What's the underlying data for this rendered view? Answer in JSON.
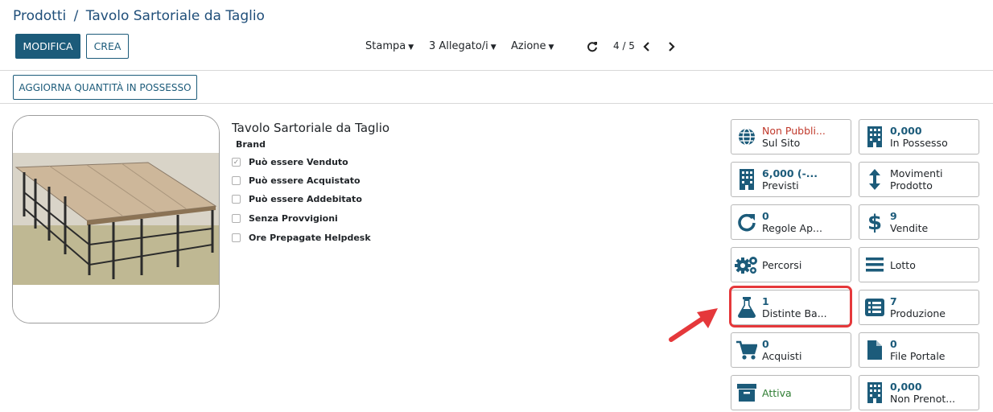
{
  "breadcrumb": {
    "parent": "Prodotti",
    "separator": "/",
    "current": "Tavolo Sartoriale da Taglio"
  },
  "toolbar": {
    "edit": "MODIFICA",
    "create": "CREA",
    "print": "Stampa",
    "attachments": "3 Allegato/i",
    "action": "Azione",
    "pager": "4 / 5"
  },
  "secondary": {
    "update_qty": "AGGIORNA QUANTITÀ IN POSSESSO"
  },
  "product": {
    "name": "Tavolo Sartoriale da Taglio",
    "brand_label": "Brand",
    "options": [
      {
        "label": "Può essere Venduto",
        "checked": true
      },
      {
        "label": "Può essere Acquistato",
        "checked": false
      },
      {
        "label": "Può essere Addebitato",
        "checked": false
      },
      {
        "label": "Senza Provvigioni",
        "checked": false
      },
      {
        "label": "Ore Prepagate Helpdesk",
        "checked": false
      }
    ]
  },
  "smart_buttons": {
    "website": {
      "value": "Non Pubbli...",
      "label": "Sul Sito",
      "icon": "globe-icon"
    },
    "on_hand": {
      "value": "0,000",
      "label": "In Possesso",
      "icon": "building-icon"
    },
    "forecast": {
      "value": "6,000 (-...",
      "label": "Previsti",
      "icon": "building-icon"
    },
    "moves": {
      "line1": "Movimenti",
      "line2": "Prodotto",
      "icon": "arrows-vertical-icon"
    },
    "reorder": {
      "value": "0",
      "label": "Regole Ap...",
      "icon": "refresh-icon"
    },
    "sales": {
      "value": "9",
      "label": "Vendite",
      "icon": "dollar-icon"
    },
    "routes": {
      "label": "Percorsi",
      "icon": "cogs-icon"
    },
    "lots": {
      "label": "Lotto",
      "icon": "bars-icon"
    },
    "bom": {
      "value": "1",
      "label": "Distinte Ba...",
      "icon": "flask-icon"
    },
    "production": {
      "value": "7",
      "label": "Produzione",
      "icon": "list-icon"
    },
    "purchases": {
      "value": "0",
      "label": "Acquisti",
      "icon": "cart-icon"
    },
    "portal_files": {
      "value": "0",
      "label": "File Portale",
      "icon": "file-icon"
    },
    "active": {
      "label": "Attiva",
      "icon": "archive-icon"
    },
    "reserved": {
      "value": "0,000",
      "label": "Non Prenot...",
      "icon": "building-icon"
    }
  },
  "colors": {
    "primary": "#1c5b7a",
    "unpublished": "#c0392b",
    "active": "#2e7d32",
    "highlight": "#e5383b"
  }
}
